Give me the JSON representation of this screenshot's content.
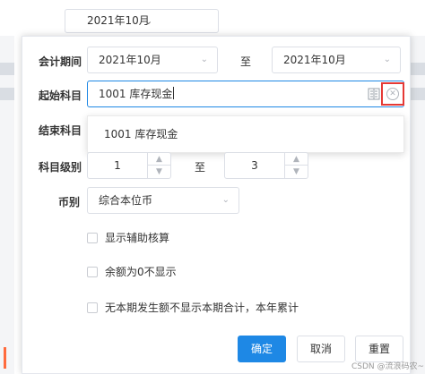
{
  "background": {
    "top_select_value": "2021年10月"
  },
  "form": {
    "period": {
      "label": "会计期间",
      "from": "2021年10月",
      "to_label": "至",
      "to": "2021年10月"
    },
    "start_account": {
      "label": "起始科目",
      "value": "1001 库存现金"
    },
    "account_dropdown": {
      "options": [
        "1001 库存现金"
      ]
    },
    "end_account": {
      "label": "结束科目"
    },
    "level": {
      "label": "科目级别",
      "from": "1",
      "to_label": "至",
      "to": "3"
    },
    "currency": {
      "label": "币别",
      "value": "综合本位币"
    },
    "options": [
      {
        "label": "显示辅助核算",
        "checked": false
      },
      {
        "label": "余额为0不显示",
        "checked": false
      },
      {
        "label": "无本期发生额不显示本期合计，本年累计",
        "checked": false
      }
    ]
  },
  "buttons": {
    "confirm": "确定",
    "cancel": "取消",
    "reset": "重置"
  },
  "watermark": "CSDN @流浪码农~",
  "colors": {
    "primary": "#1e88e5",
    "highlight_box": "#e53935",
    "accent": "#ff6b3d"
  },
  "icons": {
    "chevron": "chevron-down-icon",
    "book": "book-icon",
    "clear": "clear-icon"
  }
}
